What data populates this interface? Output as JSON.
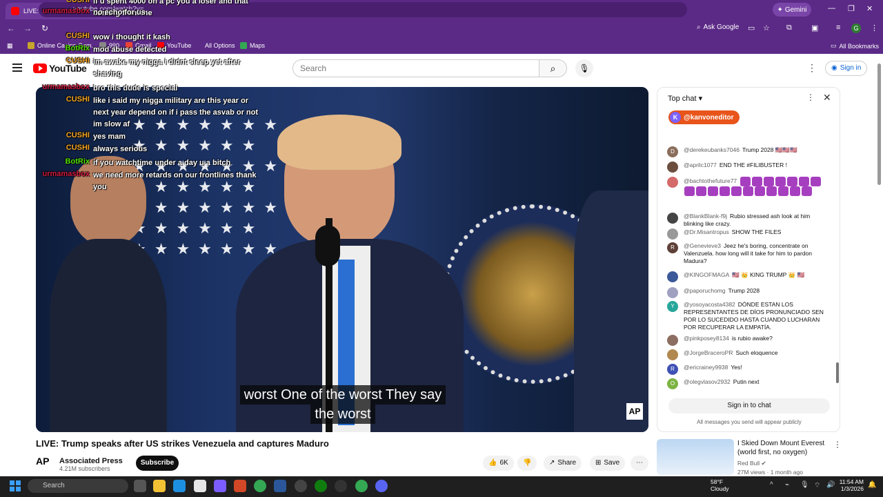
{
  "browser": {
    "tab_title": "LIVE: Trump speaks after US...",
    "url": "youtube.com/watch?v=...",
    "gemini_label": "Gemini",
    "ask_google": "Ask Google",
    "profile_initial": "G",
    "bookmarks": [
      {
        "label": "Online Casino Gam...",
        "color": "#c6a52c"
      },
      {
        "label": "990",
        "color": "#888"
      },
      {
        "label": "Gmail",
        "color": "#ea4335"
      },
      {
        "label": "YouTube",
        "color": "#ff0000"
      },
      {
        "label": "All Options",
        "color": "#5b2a86"
      },
      {
        "label": "Maps",
        "color": "#34a853"
      }
    ],
    "all_bookmarks": "All Bookmarks"
  },
  "youtube": {
    "logo_text": "YouTube",
    "search_placeholder": "Search",
    "sign_in": "Sign in"
  },
  "overlay_chat": [
    {
      "name": "CUSHI",
      "color": "#f5a623",
      "msg": "if u spent 4000 on a pc you a loser and that coming from me"
    },
    {
      "name": "urmamasbox",
      "color": "#d0193e",
      "msg": "no echo for us"
    },
    {
      "name": "CUSHI",
      "color": "#f5a623",
      "msg": "wow i thought it kash"
    },
    {
      "name": "BotRix",
      "color": "#52e000",
      "msg": "mod abuse detected"
    },
    {
      "name": "CUSHI",
      "color": "#f5a623",
      "msg": "im awake my nigga i didnt sleep yet after shaving"
    },
    {
      "name": "urmamasbox",
      "color": "#d0193e",
      "msg": "bro this dude is special"
    },
    {
      "name": "CUSHI",
      "color": "#f5a623",
      "msg": "like i said my nigga military are this year or next year depend on if i pass the asvab or not im slow af"
    },
    {
      "name": "CUSHI",
      "color": "#f5a623",
      "msg": "yes mam"
    },
    {
      "name": "CUSHI",
      "color": "#f5a623",
      "msg": "always serious"
    },
    {
      "name": "BotRix",
      "color": "#52e000",
      "msg": "if you watchtime under a day u a bitch"
    },
    {
      "name": "urmamasbox",
      "color": "#d0193e",
      "msg": "we need more retards on our frontlines thank you"
    }
  ],
  "video": {
    "caption_line1": "worst One of the worst They say",
    "caption_line2": "the worst",
    "watermark": "AP",
    "title": "LIVE: Trump speaks after US strikes Venezuela and captures Maduro",
    "channel_logo": "AP",
    "channel_name": "Associated Press",
    "subscribers": "4.21M subscribers",
    "subscribe": "Subscribe",
    "likes": "6K",
    "share": "Share",
    "save": "Save"
  },
  "live_chat": {
    "mode": "Top chat",
    "pinned": "@kanvoneditor",
    "pinned_initial": "K",
    "messages": [
      {
        "user": "@derekeubanks7046",
        "text": "Trump 2028 🇺🇸🇺🇸🇺🇸",
        "avatar": "D",
        "color": "#8a6d5b"
      },
      {
        "user": "@aprilc1077",
        "text": "END THE #FILIBUSTER !",
        "avatar": "",
        "color": "#6b4e3d"
      },
      {
        "user": "@bachtothefuture77",
        "text": "",
        "avatar": "",
        "color": "#d46a6a",
        "emotes": 18
      },
      {
        "user": "@BlankBlank-f9j",
        "text": "Rubio stressed ash look at him blinking like crazy.",
        "avatar": "",
        "color": "#444"
      },
      {
        "user": "@Dr.Misantropus",
        "text": "SHOW THE FILES",
        "avatar": "",
        "color": "#999"
      },
      {
        "user": "@Genevieve3",
        "text": "Jeez he's boring, concentrate on Valenzuela. how long will it take for him to pardon Madura?",
        "avatar": "R",
        "color": "#5d4037"
      },
      {
        "user": "@KINGOFMAGA",
        "text": "🇺🇸 👑 KING TRUMP 👑 🇺🇸",
        "avatar": "",
        "color": "#3b5998"
      },
      {
        "user": "@paporuchomg",
        "text": "Trump 2028",
        "avatar": "",
        "color": "#a0a0c0"
      },
      {
        "user": "@yosoyacosta4382",
        "text": "DÓNDE ESTAN LOS REPRESENTANTES DE DÍOS PRONUNCIADO SEN POR LO SUCEDIDO HASTA CUANDO LUCHARAN POR RECUPERAR LA EMPATÍA.",
        "avatar": "Y",
        "color": "#26a69a"
      },
      {
        "user": "@pinkposey8134",
        "text": "is rubio awake?",
        "avatar": "",
        "color": "#8d6e63"
      },
      {
        "user": "@JorgeBraceroPR",
        "text": "Such eloquence",
        "avatar": "",
        "color": "#b08850"
      },
      {
        "user": "@ericrainey9938",
        "text": "Yes!",
        "avatar": "R",
        "color": "#3f51b5"
      },
      {
        "user": "@olegvlasov2932",
        "text": "Putin next",
        "avatar": "O",
        "color": "#7cb342"
      }
    ],
    "sign_in": "Sign in to chat",
    "note": "All messages you send will appear publicly"
  },
  "recommended": {
    "title": "I Skied Down Mount Everest (world first, no oxygen)",
    "channel": "Red Bull",
    "meta": "27M views · 1 month ago"
  },
  "taskbar": {
    "search": "Search",
    "temperature": "58°F",
    "weather": "Cloudy",
    "time": "11:54 AM",
    "date": "1/3/2026"
  }
}
